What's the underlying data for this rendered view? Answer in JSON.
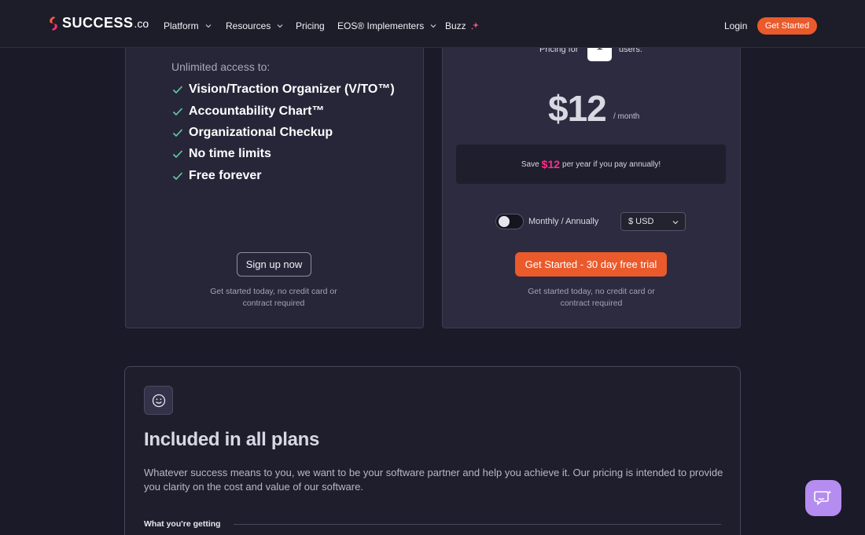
{
  "nav": {
    "logo": {
      "text": "SUCCESS",
      "suffix": ".co",
      "icon": "success-logo-mark"
    },
    "items": [
      {
        "label": "Platform",
        "has_dropdown": true
      },
      {
        "label": "Resources",
        "has_dropdown": true
      },
      {
        "label": "Pricing",
        "has_dropdown": false
      },
      {
        "label": "EOS® Implementers",
        "has_dropdown": true
      },
      {
        "label": "Buzz",
        "has_dropdown": false,
        "icon": "sparkle-icon"
      }
    ],
    "login": "Login",
    "cta": "Get Started"
  },
  "free_plan": {
    "unlimited_label": "Unlimited access to:",
    "features": [
      "Vision/Traction Organizer (V/TO™)",
      "Accountability Chart™",
      "Organizational Checkup",
      "No time limits",
      "Free forever"
    ],
    "button": "Sign up now",
    "note": "Get started today, no credit card or contract required"
  },
  "paid_plan": {
    "pricing_for": "Pricing for",
    "users_value": "1",
    "users_label": "users:",
    "price": "$12",
    "period": "/ month",
    "save_prefix": "Save",
    "save_amount": "$12",
    "save_suffix": "per year if you pay annually!",
    "toggle_label": "Monthly / Annually",
    "toggle_on": false,
    "currency": "$ USD",
    "button": "Get Started - 30 day free trial",
    "note": "Get started today, no credit card or contract required"
  },
  "included": {
    "icon": "smile-icon",
    "title": "Included in all plans",
    "description": "Whatever success means to you, we want to be your software partner and help you achieve it. Our pricing is intended to provide you clarity on the cost and value of our software.",
    "section_label": "What you're getting"
  },
  "chat": {
    "icon": "chat-bubble-icon"
  },
  "colors": {
    "background": "#1b1a28",
    "accent": "#ea5a2b",
    "save_highlight": "#ff2f8e",
    "check": "#5fd0a6",
    "chat": "#b58cf0"
  }
}
